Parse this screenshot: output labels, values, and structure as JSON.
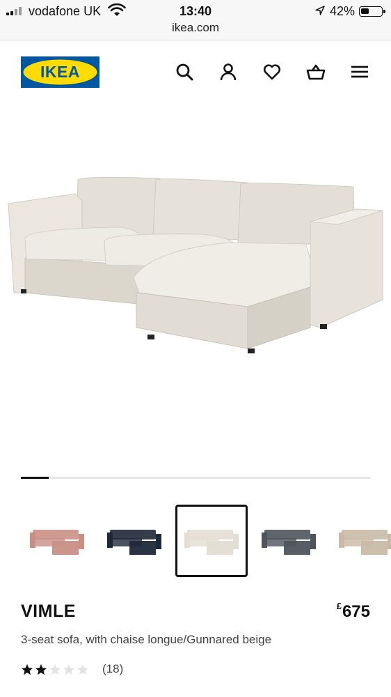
{
  "status_bar": {
    "carrier": "vodafone UK",
    "time": "13:40",
    "battery": "42%",
    "battery_level": 0.42,
    "url": "ikea.com"
  },
  "header": {
    "logo_text": "IKEA",
    "icons": [
      "search-icon",
      "account-icon",
      "heart-icon",
      "basket-icon",
      "menu-icon"
    ]
  },
  "gallery": {
    "progress": 0.08,
    "selected_index": 2,
    "swatches": [
      {
        "name": "pink",
        "color": "#c98f86"
      },
      {
        "name": "dark-blue",
        "color": "#1f2838"
      },
      {
        "name": "beige",
        "color": "#e3ddd2"
      },
      {
        "name": "grey",
        "color": "#4f535c"
      },
      {
        "name": "light-brown",
        "color": "#c8baa6"
      }
    ]
  },
  "product": {
    "name": "VIMLE",
    "currency": "£",
    "price": "675",
    "description": "3-seat sofa, with chaise longue/Gunnared beige",
    "rating": 2,
    "rating_max": 5,
    "review_count": "(18)"
  },
  "colors": {
    "ikea_blue": "#0058a3",
    "ikea_yellow": "#ffdb00"
  }
}
